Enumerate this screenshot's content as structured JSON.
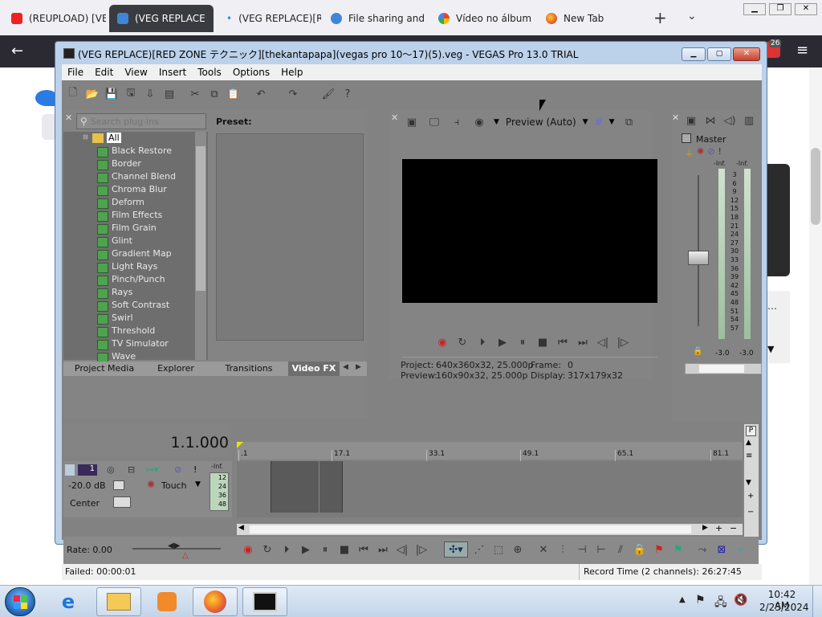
{
  "browser": {
    "tabs": [
      {
        "title": "(REUPLOAD) [VE",
        "icon": "youtube-icon",
        "color": "#e22"
      },
      {
        "title": "(VEG REPLACE",
        "icon": "vegas-favicon",
        "color": "#3e87d8"
      },
      {
        "title": "(VEG REPLACE)[R",
        "icon": "vegas-favicon",
        "color": "#3e87d8"
      },
      {
        "title": "File sharing and s",
        "icon": "cloud-icon",
        "color": "#3e87d8"
      },
      {
        "title": "Vídeo no álbum",
        "icon": "photos-icon",
        "color": "#e8a020"
      },
      {
        "title": "New Tab",
        "icon": "firefox-icon",
        "color": "#e6622b"
      }
    ],
    "extension_badge": "26"
  },
  "vegas": {
    "title": "(VEG REPLACE)[RED ZONE テクニック][thekantapapa](vegas pro 10〜17)(5).veg - VEGAS Pro 13.0 TRIAL",
    "menu": [
      "File",
      "Edit",
      "View",
      "Insert",
      "Tools",
      "Options",
      "Help"
    ],
    "search_placeholder": "Search plug-ins",
    "preset_label": "Preset:",
    "fx_root": "All",
    "fx_items": [
      "Black Restore",
      "Border",
      "Channel Blend",
      "Chroma Blur",
      "Deform",
      "Film Effects",
      "Film Grain",
      "Glint",
      "Gradient Map",
      "Light Rays",
      "Pinch/Punch",
      "Rays",
      "Soft Contrast",
      "Swirl",
      "Threshold",
      "TV Simulator",
      "Wave"
    ],
    "panel_tabs": [
      "Project Media",
      "Explorer",
      "Transitions",
      "Video FX"
    ],
    "preview_mode": "Preview (Auto)",
    "project_label": "Project:",
    "project_value": "640x360x32, 25.000p",
    "preview_label": "Preview:",
    "preview_value": "160x90x32, 25.000p",
    "frame_label": "Frame:",
    "frame_value": "0",
    "display_label": "Display:",
    "display_value": "317x179x32",
    "master_label": "Master",
    "meter_inf_left": "-Inf.",
    "meter_inf_right": "-Inf.",
    "meter_scale": [
      "3",
      "6",
      "9",
      "12",
      "15",
      "18",
      "21",
      "24",
      "27",
      "30",
      "33",
      "36",
      "39",
      "42",
      "45",
      "48",
      "51",
      "54",
      "57"
    ],
    "meter_bottom_left": "-3.0",
    "meter_bottom_right": "-3.0",
    "timecode": "1.1.000",
    "ruler_marks": [
      ".1",
      "17.1",
      "33.1",
      "49.1",
      "65.1",
      "81.1"
    ],
    "track_number": "1",
    "track_volume": "-20.0 dB",
    "track_mode": "Touch",
    "track_pan": "Center",
    "track_meter_inf": "-Inf.",
    "track_meter_ticks": [
      "12",
      "24",
      "36",
      "48"
    ],
    "rate": "Rate: 0.00",
    "status_left": "Failed: 00:00:01",
    "status_right": "Record Time (2 channels): 26:27:45"
  },
  "taskbar": {
    "time": "10:42 AM",
    "date": "2/25/2024"
  }
}
